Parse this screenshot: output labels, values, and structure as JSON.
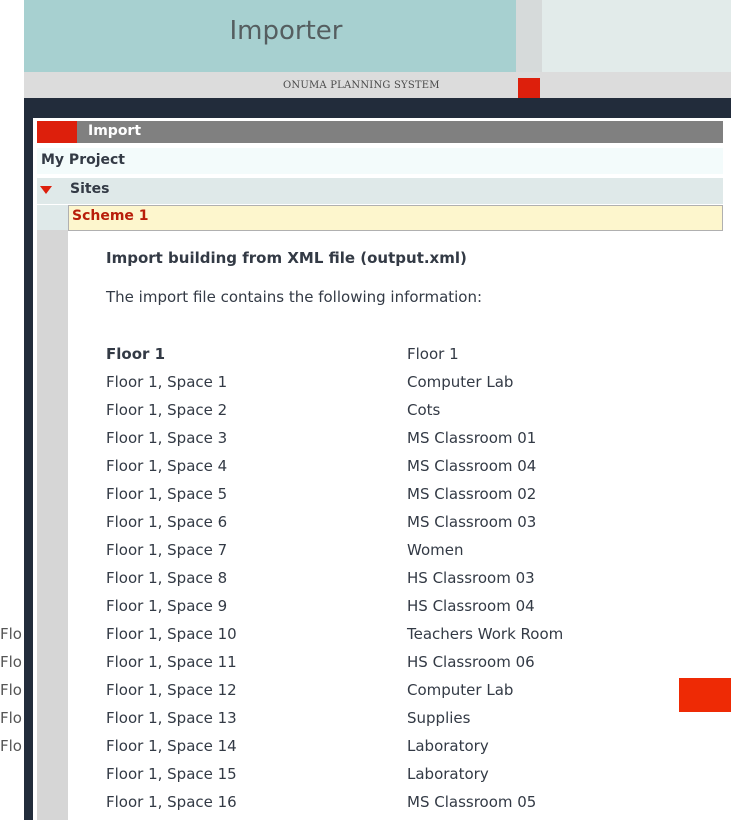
{
  "window": {
    "title": "Importer",
    "subtitle": "ONUMA PLANNING SYSTEM"
  },
  "sidebar": {
    "section_label": "Import",
    "project_label": "My Project",
    "sites_label": "Sites",
    "scheme_label": "Scheme 1"
  },
  "main": {
    "heading": "Import building from XML file (output.xml)",
    "description": "The import file contains the following information:",
    "rows": [
      {
        "item": "Floor 1",
        "name": "Floor 1"
      },
      {
        "item": "Floor 1, Space 1",
        "name": "Computer Lab"
      },
      {
        "item": "Floor 1, Space 2",
        "name": "Cots"
      },
      {
        "item": "Floor 1, Space 3",
        "name": "MS Classroom 01"
      },
      {
        "item": "Floor 1, Space 4",
        "name": "MS Classroom 04"
      },
      {
        "item": "Floor 1, Space 5",
        "name": "MS Classroom 02"
      },
      {
        "item": "Floor 1, Space 6",
        "name": "MS Classroom 03"
      },
      {
        "item": "Floor 1, Space 7",
        "name": "Women"
      },
      {
        "item": "Floor 1, Space 8",
        "name": "HS Classroom 03"
      },
      {
        "item": "Floor 1, Space 9",
        "name": "HS Classroom 04"
      },
      {
        "item": "Floor 1, Space 10",
        "name": "Teachers Work Room"
      },
      {
        "item": "Floor 1, Space 11",
        "name": "HS Classroom 06"
      },
      {
        "item": "Floor 1, Space 12",
        "name": "Computer Lab"
      },
      {
        "item": "Floor 1, Space 13",
        "name": "Supplies"
      },
      {
        "item": "Floor 1, Space 14",
        "name": "Laboratory"
      },
      {
        "item": "Floor 1, Space 15",
        "name": "Laboratory"
      },
      {
        "item": "Floor 1, Space 16",
        "name": "MS Classroom 05"
      }
    ]
  },
  "background_fragments": [
    "Flo",
    "Flo",
    "Flo",
    "Flo",
    "Flo"
  ],
  "colors": {
    "header": "#a7d0d0",
    "dark_frame": "#222c3b",
    "accent_red": "#dd1f0c",
    "import_bar": "#808080",
    "scheme_highlight": "#fdf6cd",
    "scheme_text": "#b81e0a"
  },
  "icons": {
    "sites_toggle": "caret-down-icon"
  }
}
